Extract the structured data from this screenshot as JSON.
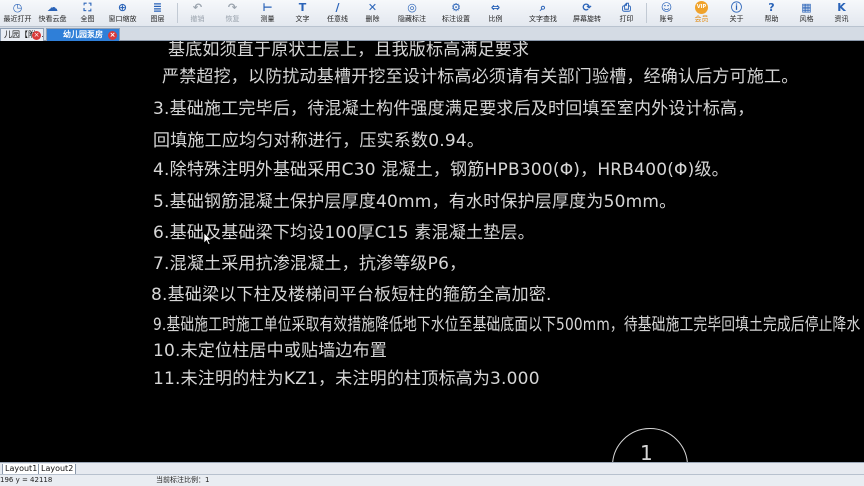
{
  "toolbar": {
    "buttons": [
      {
        "label": "最近打开",
        "icon": "clock-icon"
      },
      {
        "label": "快看云盘",
        "icon": "cloud-icon"
      },
      {
        "label": "全图",
        "icon": "fit-icon"
      },
      {
        "label": "窗口缩放",
        "icon": "zoom-window-icon"
      },
      {
        "label": "图层",
        "icon": "layers-icon"
      },
      {
        "label": "撤销",
        "icon": "undo-icon"
      },
      {
        "label": "恢复",
        "icon": "redo-icon"
      },
      {
        "label": "测量",
        "icon": "measure-icon"
      },
      {
        "label": "文字",
        "icon": "text-icon"
      },
      {
        "label": "任意线",
        "icon": "line-icon"
      },
      {
        "label": "删除",
        "icon": "delete-icon"
      },
      {
        "label": "隐藏标注",
        "icon": "hide-annotation-icon"
      },
      {
        "label": "标注设置",
        "icon": "annotation-settings-icon"
      },
      {
        "label": "比例",
        "icon": "scale-icon"
      },
      {
        "label": "文字查找",
        "icon": "text-search-icon"
      },
      {
        "label": "屏幕旋转",
        "icon": "rotate-icon"
      },
      {
        "label": "打印",
        "icon": "print-icon"
      },
      {
        "label": "账号",
        "icon": "account-icon"
      },
      {
        "label": "会员",
        "icon": "vip-icon"
      },
      {
        "label": "关于",
        "icon": "info-icon"
      },
      {
        "label": "帮助",
        "icon": "help-icon"
      },
      {
        "label": "风格",
        "icon": "style-icon"
      },
      {
        "label": "资讯",
        "icon": "news-icon"
      }
    ],
    "vip_badge": "VIP",
    "accent_color": "#2a63b8",
    "vip_color": "#f0a22a"
  },
  "tabs": [
    {
      "label": "儿园【附…",
      "active": false
    },
    {
      "label": "幼儿园泵房",
      "active": true
    }
  ],
  "tab_close_glyph": "×",
  "drawing": {
    "notes": [
      "基底如须直于原状土层上，且我版标高满足要求",
      "严禁超挖，以防扰动基槽开挖至设计标高必须请有关部门验槽，经确认后方可施工。",
      "3.基础施工完毕后，待混凝土构件强度满足要求后及时回填至室内外设计标高，",
      "回填施工应均匀对称进行，压实系数0.94。",
      "4.除特殊注明外基础采用C30 混凝土，钢筋HPB300(Φ)，HRB400(Φ)级。",
      "5.基础钢筋混凝土保护层厚度40mm，有水时保护层厚度为50mm。",
      "6.基础及基础梁下均设100厚C15 素混凝土垫层。",
      "7.混凝土采用抗渗混凝土，抗渗等级P6，",
      "8.基础梁以下柱及楼梯间平台板短柱的箍筋全高加密.",
      "9.基础施工时施工单位采取有效措施降低地下水位至基础底面以下500mm，待基础施工完毕回填土完成后停止降水",
      "10.未定位柱居中或贴墙边布置",
      "11.未注明的柱为KZ1，未注明的柱顶标高为3.000"
    ],
    "circle_label": "1",
    "text_color": "#d6d6d6",
    "background": "#000000"
  },
  "layout_tabs": [
    "Layout1",
    "Layout2"
  ],
  "status": {
    "coords": "196 y = 42118",
    "scale": "当前标注比例：1"
  }
}
